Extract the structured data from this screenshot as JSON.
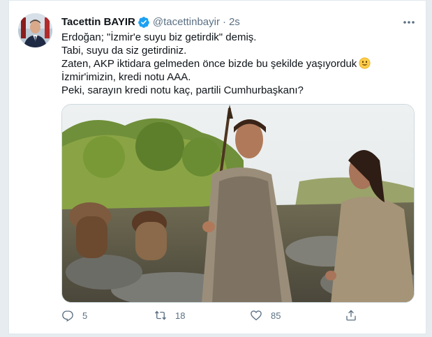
{
  "author": {
    "name": "Tacettin BAYIR",
    "handle": "@tacettinbayir",
    "separator": "·",
    "time": "2s"
  },
  "tweet": {
    "lines": [
      "Erdoğan; \"İzmir'e suyu biz getirdik\" demiş.",
      "Tabi, suyu da siz getirdiniz.",
      "Zaten, AKP iktidara gelmeden önce bizde bu şekilde yaşıyorduk",
      "İzmir'imizin, kredi notu AAA.",
      "Peki, sarayın kredi notu kaç, partili Cumhurbaşkanı?"
    ],
    "emoji": "smiling-face-icon"
  },
  "actions": {
    "reply_count": "5",
    "retweet_count": "18",
    "like_count": "85"
  },
  "colors": {
    "accent": "#1da1f2",
    "muted": "#5b7083",
    "text": "#0f1419",
    "border": "#e1e8ed"
  }
}
